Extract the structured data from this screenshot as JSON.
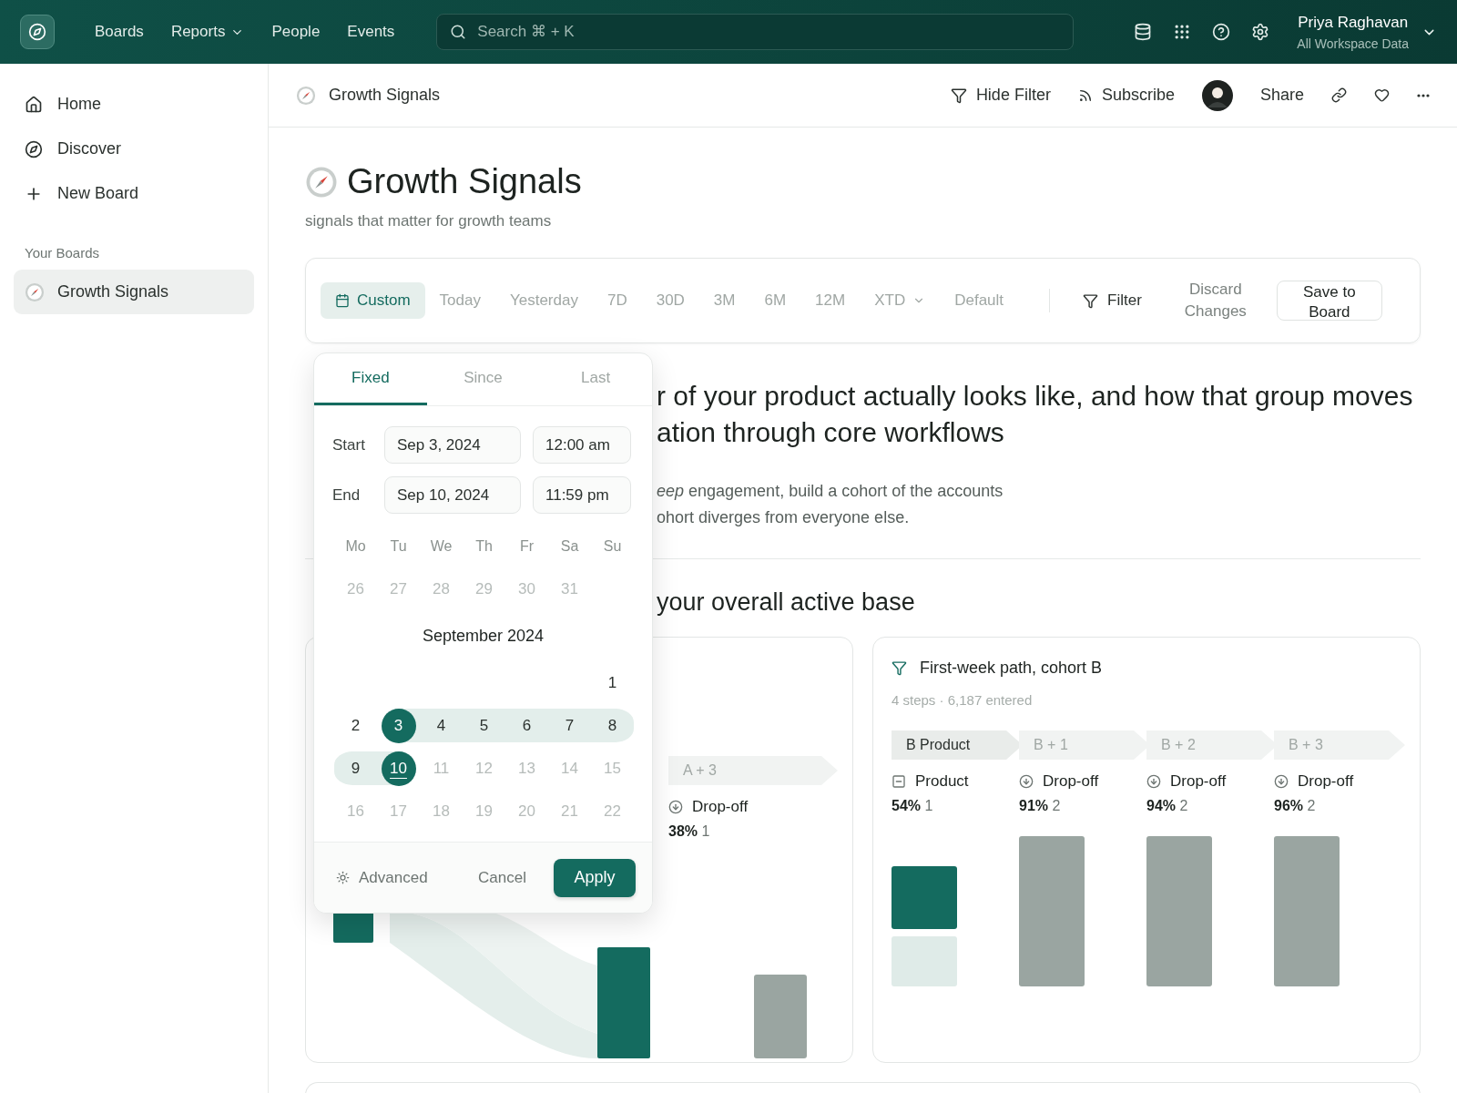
{
  "topbar": {
    "nav": [
      {
        "label": "Boards",
        "has_menu": false
      },
      {
        "label": "Reports",
        "has_menu": true
      },
      {
        "label": "People",
        "has_menu": false
      },
      {
        "label": "Events",
        "has_menu": false
      }
    ],
    "search": {
      "placeholder": "Search ⌘ + K"
    },
    "tools": [
      {
        "kind": "database"
      },
      {
        "kind": "apps"
      },
      {
        "kind": "help"
      },
      {
        "kind": "settings"
      }
    ],
    "user": {
      "name": "Priya Raghavan",
      "scope": "All Workspace Data"
    }
  },
  "sidebar": {
    "items": [
      {
        "kind": "home",
        "label": "Home"
      },
      {
        "kind": "discover",
        "label": "Discover"
      },
      {
        "kind": "new",
        "label": "New Board"
      }
    ],
    "section": "Your Boards",
    "boards": [
      {
        "label": "Growth Signals",
        "selected": true
      }
    ]
  },
  "header": {
    "title": "Growth Signals",
    "actions": [
      {
        "kind": "filter",
        "label": "Hide Filter"
      },
      {
        "kind": "subscribe",
        "label": "Subscribe"
      },
      {
        "kind": "avatar"
      },
      {
        "kind": "share",
        "label": "Share"
      },
      {
        "kind": "link"
      },
      {
        "kind": "favorite"
      },
      {
        "kind": "more"
      }
    ]
  },
  "page": {
    "title": "Growth Signals",
    "subtitle": "signals that matter for growth teams"
  },
  "range_bar": {
    "options": [
      {
        "label": "Custom",
        "selected": true,
        "has_menu": false
      },
      {
        "label": "Today",
        "selected": false,
        "has_menu": false
      },
      {
        "label": "Yesterday",
        "selected": false,
        "has_menu": false
      },
      {
        "label": "7D",
        "selected": false,
        "has_menu": false
      },
      {
        "label": "30D",
        "selected": false,
        "has_menu": false
      },
      {
        "label": "3M",
        "selected": false,
        "has_menu": false
      },
      {
        "label": "6M",
        "selected": false,
        "has_menu": false
      },
      {
        "label": "12M",
        "selected": false,
        "has_menu": false
      },
      {
        "label": "XTD",
        "selected": false,
        "has_menu": true
      },
      {
        "label": "Default",
        "selected": false,
        "has_menu": false
      }
    ],
    "filter": "Filter",
    "discard": "Discard Changes",
    "save": "Save to Board"
  },
  "intro": {
    "heading_lines": [
      "r of your product actually looks like, and how that group moves",
      "ation through core workflows"
    ],
    "paragraph_lines": [
      "*eep* engagement, build a cohort of the accounts",
      "ohort diverges from everyone else."
    ],
    "section": "your overall active base"
  },
  "date_picker": {
    "tabs": [
      {
        "label": "Fixed",
        "selected": true
      },
      {
        "label": "Since",
        "selected": false
      },
      {
        "label": "Last",
        "selected": false
      }
    ],
    "fields": [
      {
        "label": "Start",
        "date": "Sep 3, 2024",
        "time": "12:00 am"
      },
      {
        "label": "End",
        "date": "Sep 10, 2024",
        "time": "11:59 pm"
      }
    ],
    "weekdays": [
      "Mo",
      "Tu",
      "We",
      "Th",
      "Fr",
      "Sa",
      "Su"
    ],
    "previous_month": [
      "26",
      "27",
      "28",
      "29",
      "30",
      "31"
    ],
    "month": "September 2024",
    "weeks": [
      [
        {
          "day": "1",
          "selected": false,
          "in_range": false,
          "muted": false,
          "today": false
        }
      ],
      [
        {
          "day": "2",
          "selected": false,
          "in_range": false,
          "muted": false,
          "today": false
        },
        {
          "day": "3",
          "selected": true,
          "in_range": true,
          "muted": false,
          "today": false
        },
        {
          "day": "4",
          "selected": false,
          "in_range": true,
          "muted": false,
          "today": false
        },
        {
          "day": "5",
          "selected": false,
          "in_range": true,
          "muted": false,
          "today": false
        },
        {
          "day": "6",
          "selected": false,
          "in_range": true,
          "muted": false,
          "today": false
        },
        {
          "day": "7",
          "selected": false,
          "in_range": true,
          "muted": false,
          "today": false
        },
        {
          "day": "8",
          "selected": false,
          "in_range": true,
          "muted": false,
          "today": false
        }
      ],
      [
        {
          "day": "9",
          "selected": false,
          "in_range": true,
          "muted": false,
          "today": false
        },
        {
          "day": "10",
          "selected": true,
          "in_range": true,
          "muted": false,
          "today": true
        },
        {
          "day": "11",
          "selected": false,
          "in_range": false,
          "muted": true,
          "today": false
        },
        {
          "day": "12",
          "selected": false,
          "in_range": false,
          "muted": true,
          "today": false
        },
        {
          "day": "13",
          "selected": false,
          "in_range": false,
          "muted": true,
          "today": false
        },
        {
          "day": "14",
          "selected": false,
          "in_range": false,
          "muted": true,
          "today": false
        },
        {
          "day": "15",
          "selected": false,
          "in_range": false,
          "muted": true,
          "today": false
        }
      ],
      [
        {
          "day": "16",
          "selected": false,
          "in_range": false,
          "muted": true,
          "today": false
        },
        {
          "day": "17",
          "selected": false,
          "in_range": false,
          "muted": true,
          "today": false
        },
        {
          "day": "18",
          "selected": false,
          "in_range": false,
          "muted": true,
          "today": false
        },
        {
          "day": "19",
          "selected": false,
          "in_range": false,
          "muted": true,
          "today": false
        },
        {
          "day": "20",
          "selected": false,
          "in_range": false,
          "muted": true,
          "today": false
        },
        {
          "day": "21",
          "selected": false,
          "in_range": false,
          "muted": true,
          "today": false
        },
        {
          "day": "22",
          "selected": false,
          "in_range": false,
          "muted": true,
          "today": false
        }
      ]
    ],
    "footer": {
      "advanced": "Advanced",
      "cancel": "Cancel",
      "apply": "Apply"
    }
  },
  "cards": [
    {
      "kind": "flow",
      "steps": [
        {
          "chip": "A + 3",
          "selected": false,
          "kind": "dropoff",
          "label": "Drop-off",
          "percent": "38%",
          "count": "1"
        }
      ]
    },
    {
      "kind": "bars",
      "title": "First-week path, cohort B",
      "meta": "4 steps · 6,187 entered",
      "steps": [
        {
          "chip": "B Product",
          "selected": true,
          "kind": "entry",
          "label": "Product",
          "percent": "54%",
          "count": "1"
        },
        {
          "chip": "B + 1",
          "selected": false,
          "kind": "dropoff",
          "label": "Drop-off",
          "percent": "91%",
          "count": "2"
        },
        {
          "chip": "B + 2",
          "selected": false,
          "kind": "dropoff",
          "label": "Drop-off",
          "percent": "94%",
          "count": "2"
        },
        {
          "chip": "B + 3",
          "selected": false,
          "kind": "dropoff",
          "label": "Drop-off",
          "percent": "96%",
          "count": "2"
        }
      ]
    }
  ]
}
